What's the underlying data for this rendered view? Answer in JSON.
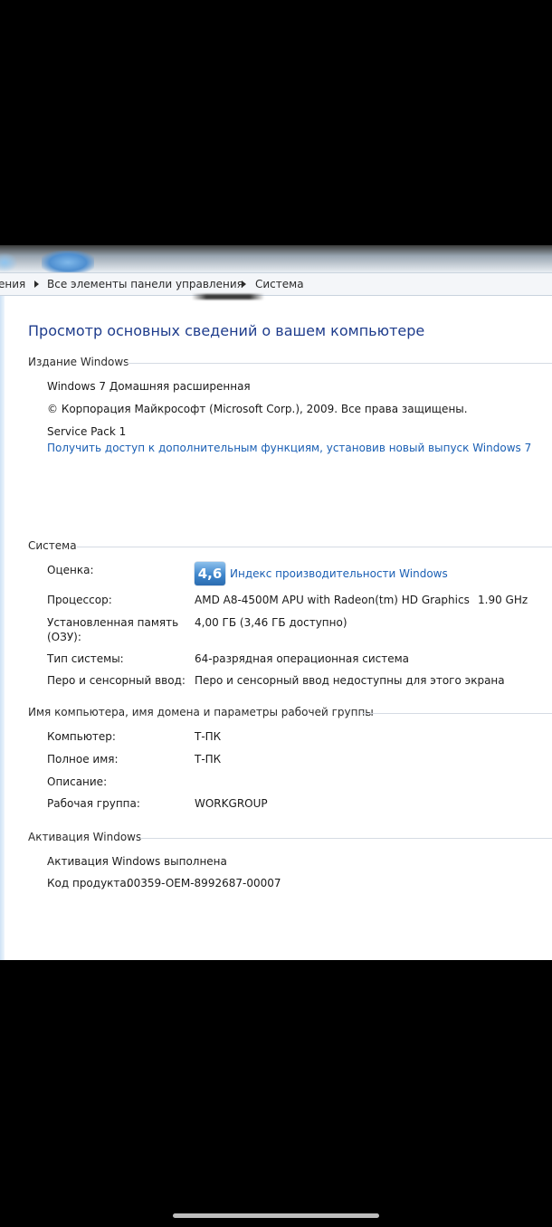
{
  "breadcrumb": {
    "item_partial": "ения",
    "item_all": "Все элементы панели управления",
    "item_system": "Система"
  },
  "page_title": "Просмотр основных сведений о вашем компьютере",
  "edition": {
    "heading": "Издание Windows",
    "name": "Windows 7 Домашняя расширенная",
    "copyright": "© Корпорация Майкрософт (Microsoft Corp.), 2009. Все права защищены.",
    "service_pack": "Service Pack 1",
    "upgrade_link": "Получить доступ к дополнительным функциям, установив новый выпуск Windows 7"
  },
  "system": {
    "heading": "Система",
    "rating_label": "Оценка:",
    "rating_value": "4,6",
    "rating_link": "Индекс производительности Windows",
    "cpu_label": "Процессор:",
    "cpu_value": "AMD A8-4500M APU with Radeon(tm) HD Graphics",
    "cpu_speed": "1.90 GHz",
    "ram_label_1": "Установленная память",
    "ram_label_2": "(ОЗУ):",
    "ram_value": "4,00 ГБ (3,46 ГБ доступно)",
    "type_label": "Тип системы:",
    "type_value": "64-разрядная операционная система",
    "pen_label": "Перо и сенсорный ввод:",
    "pen_value": "Перо и сенсорный ввод недоступны для этого экрана"
  },
  "computer": {
    "heading": "Имя компьютера, имя домена и параметры рабочей группы",
    "name_label": "Компьютер:",
    "name_value": "Т-ПК",
    "full_label": "Полное имя:",
    "full_value": "Т-ПК",
    "desc_label": "Описание:",
    "workgroup_label": "Рабочая группа:",
    "workgroup_value": "WORKGROUP"
  },
  "activation": {
    "heading": "Активация Windows",
    "status": "Активация Windows выполнена",
    "product_label": "Код продукта:",
    "product_value": "00359-OEM-8992687-00007"
  },
  "colors": {
    "title": "#1e3c8c",
    "link": "#1a5fb4",
    "badge": "#3f86cc"
  }
}
